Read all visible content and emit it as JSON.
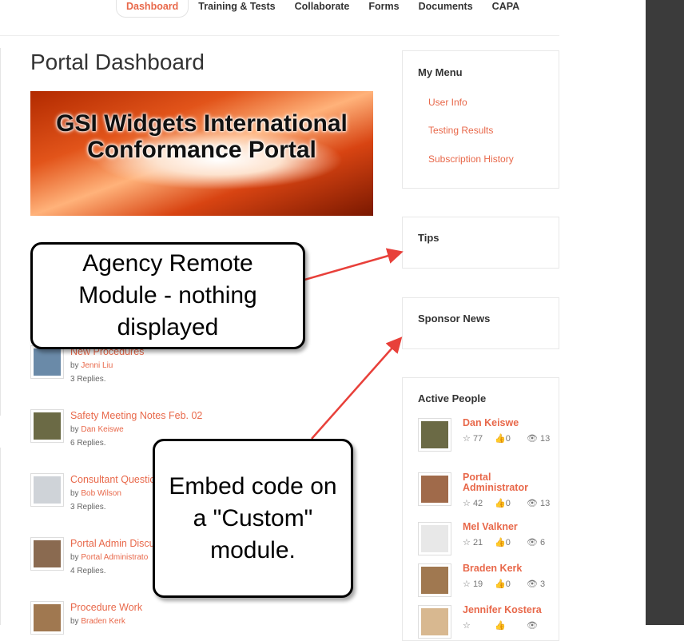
{
  "nav": [
    "Dashboard",
    "Training & Tests",
    "Collaborate",
    "Forms",
    "Documents",
    "CAPA"
  ],
  "page_title": "Portal Dashboard",
  "banner": {
    "line1": "GSI Widgets International",
    "line2": "Conformance Portal"
  },
  "topics": [
    {
      "title": "New Procedures",
      "by": "by",
      "author": "Jenni Liu",
      "replies": "3 Replies."
    },
    {
      "title": "Safety Meeting Notes Feb. 02",
      "by": "by",
      "author": "Dan Keiswe",
      "replies": "6 Replies."
    },
    {
      "title": "Consultant Questic",
      "by": "by",
      "author": "Bob Wilson",
      "replies": "3 Replies."
    },
    {
      "title": "Portal Admin Discu",
      "by": "by",
      "author": "Portal Administrato",
      "replies": "4 Replies."
    },
    {
      "title": "Procedure Work",
      "by": "by",
      "author": "Braden Kerk",
      "replies": ""
    }
  ],
  "my_menu": {
    "title": "My Menu",
    "items": [
      "User Info",
      "Testing Results",
      "Subscription History"
    ]
  },
  "tips": {
    "title": "Tips"
  },
  "sponsor": {
    "title": "Sponsor News"
  },
  "active_people": {
    "title": "Active People",
    "people": [
      {
        "name": "Dan Keiswe",
        "stars": "77",
        "likes": "0",
        "views": "13"
      },
      {
        "name": "Portal Administrator",
        "stars": "42",
        "likes": "0",
        "views": "13"
      },
      {
        "name": "Mel Valkner",
        "stars": "21",
        "likes": "0",
        "views": "6"
      },
      {
        "name": "Braden Kerk",
        "stars": "19",
        "likes": "0",
        "views": "3"
      },
      {
        "name": "Jennifer Kostera",
        "stars": "",
        "likes": "",
        "views": ""
      }
    ]
  },
  "callouts": {
    "agency": "Agency Remote Module - nothing displayed",
    "embed": "Embed code on a \"Custom\" module."
  }
}
